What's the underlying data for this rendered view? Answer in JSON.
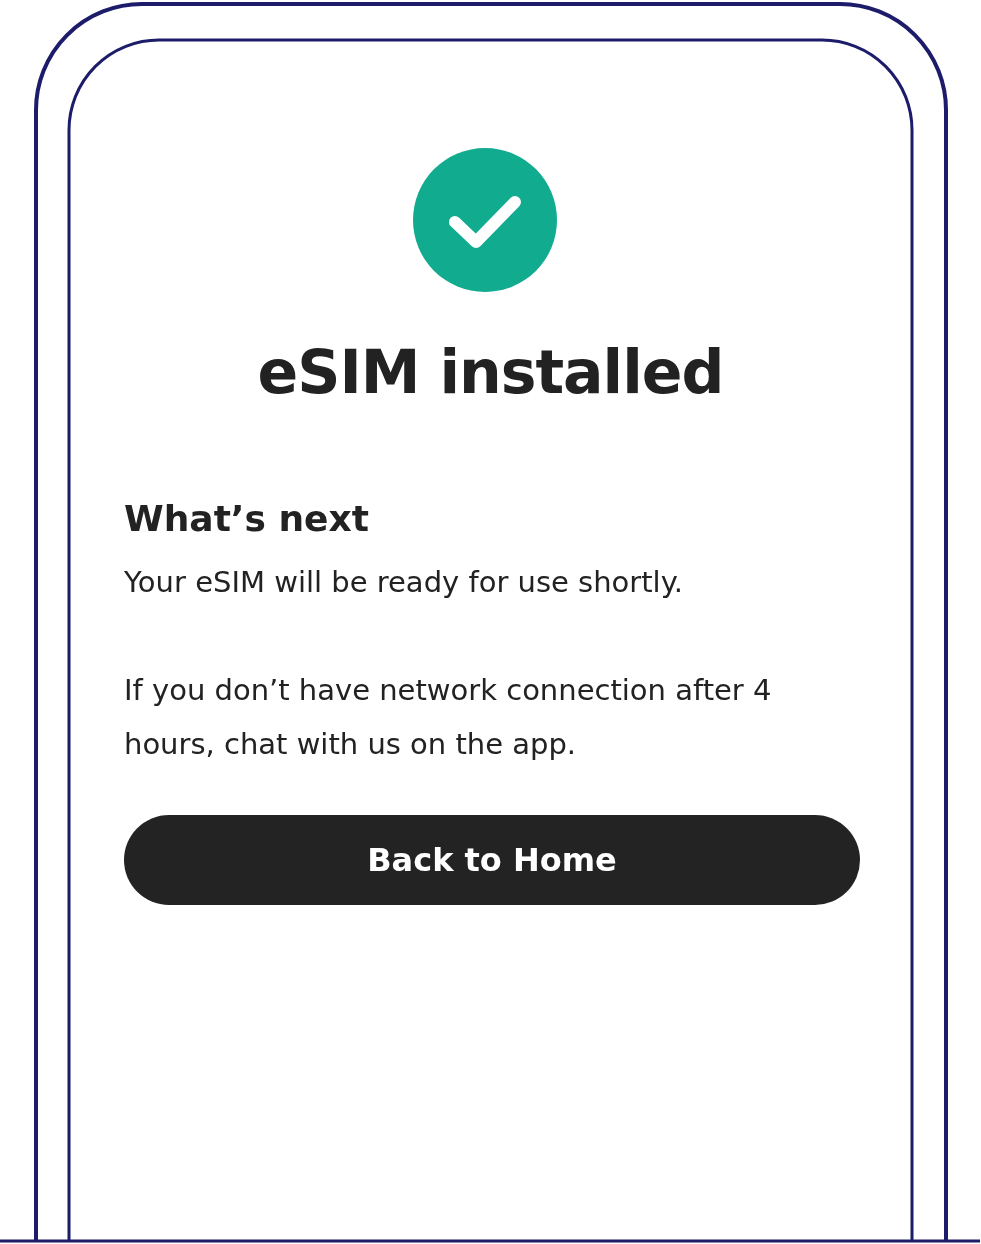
{
  "title": "eSIM installed",
  "section": {
    "heading": "What’s next",
    "paragraphs": [
      "Your eSIM will be ready for use shortly.",
      "If you don’t have network connection after 4 hours, chat with us on the app."
    ]
  },
  "button": {
    "label": "Back to Home"
  }
}
